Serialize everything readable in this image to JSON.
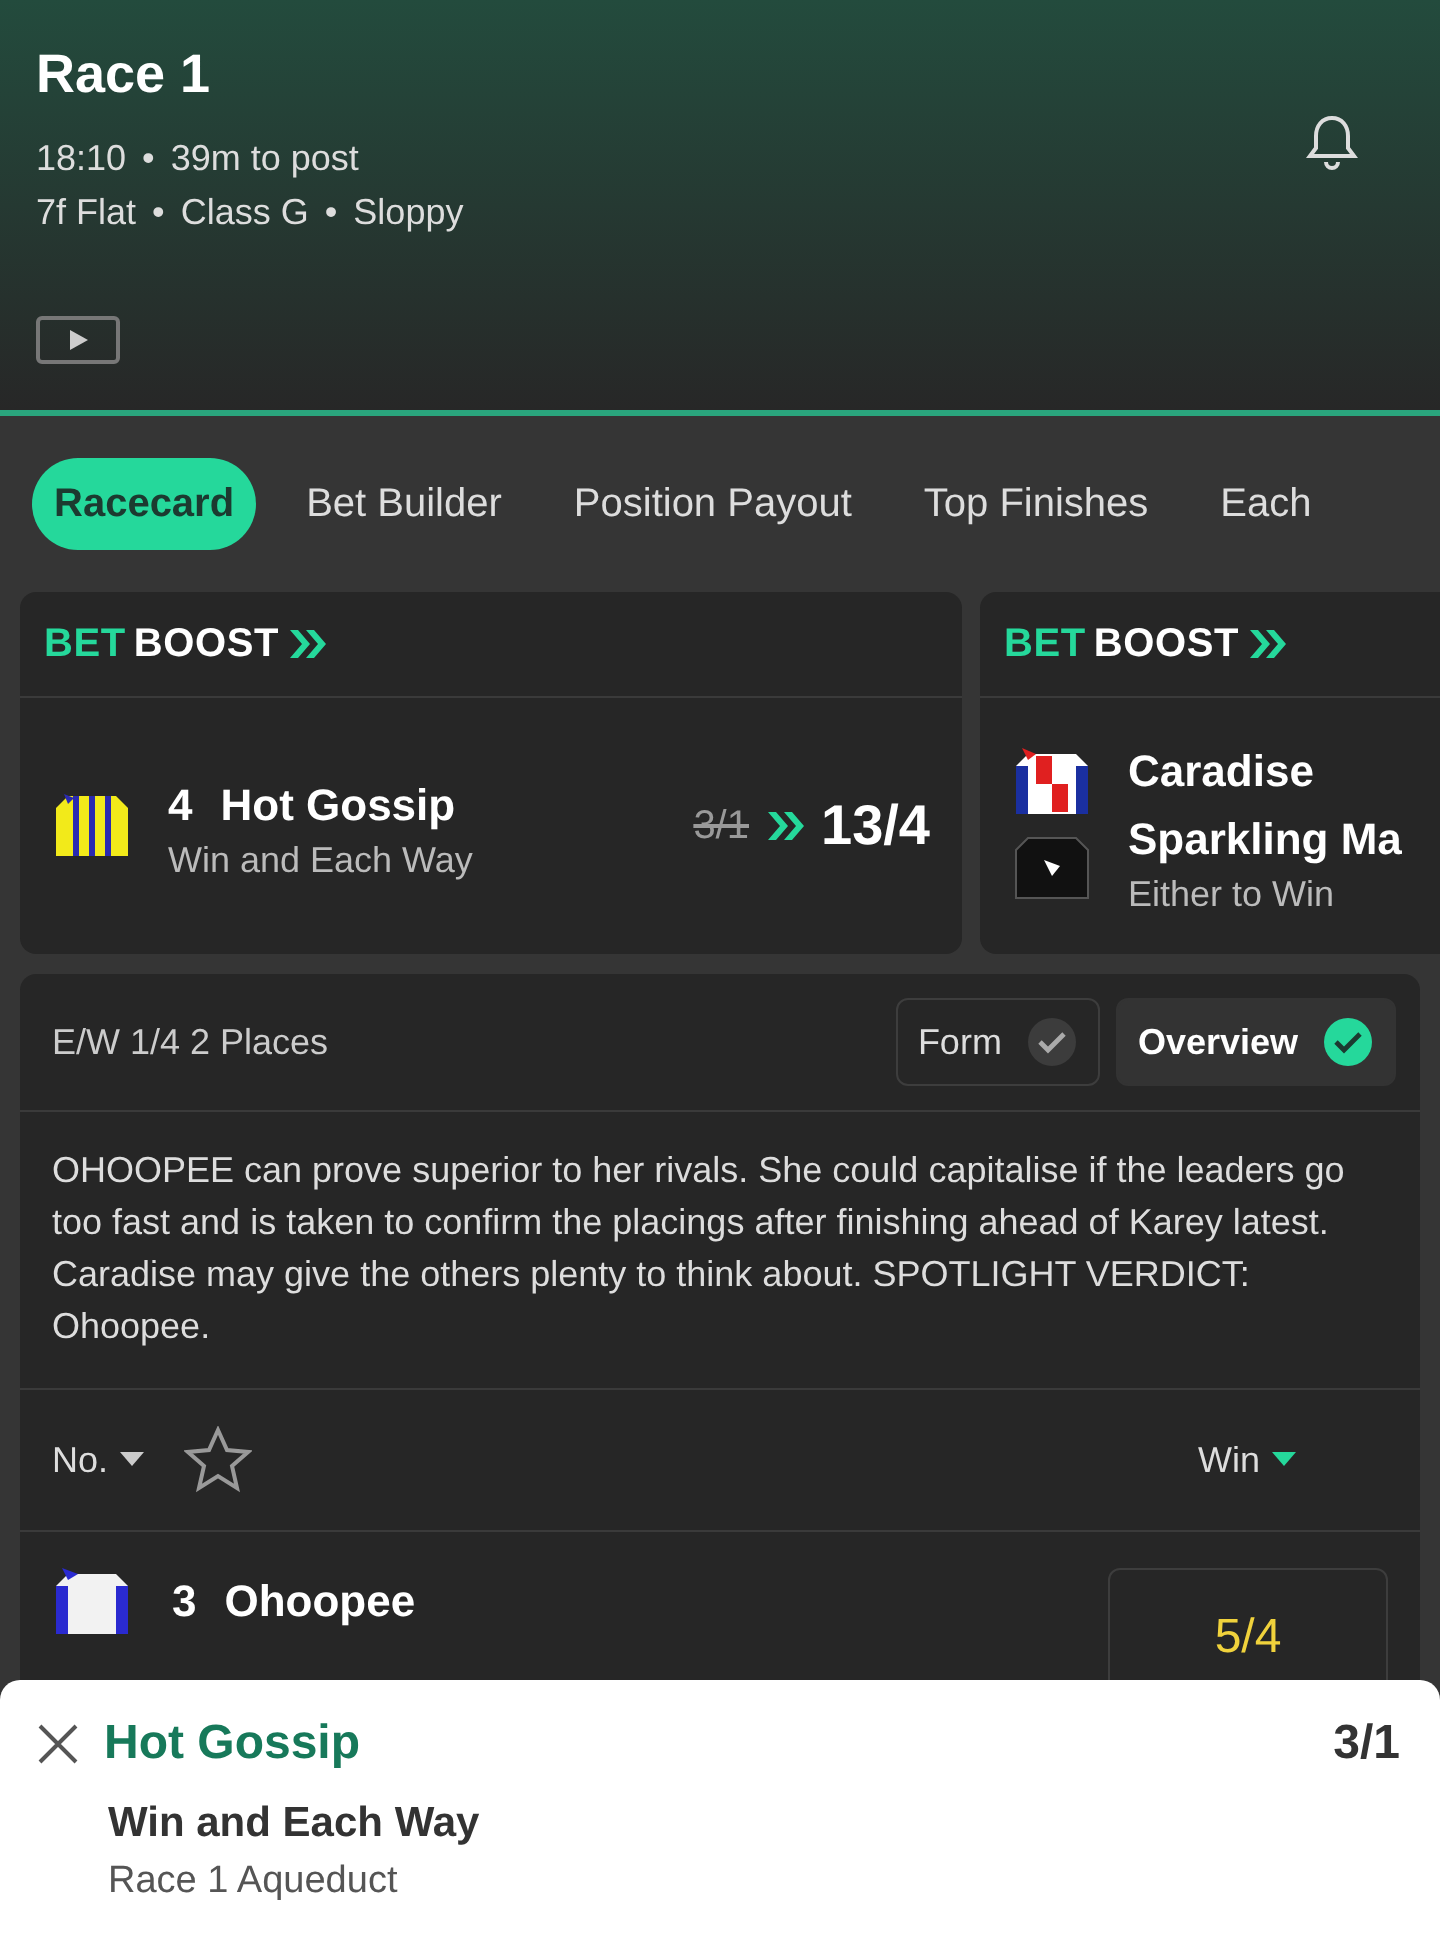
{
  "header": {
    "title": "Race 1",
    "time": "18:10",
    "separator": "•",
    "countdown": "39m to post",
    "details": [
      "7f Flat",
      "Class G",
      "Sloppy"
    ]
  },
  "tabs": [
    {
      "label": "Racecard",
      "selected": true
    },
    {
      "label": "Bet Builder",
      "selected": false
    },
    {
      "label": "Position Payout",
      "selected": false
    },
    {
      "label": "Top Finishes",
      "selected": false
    },
    {
      "label": "Each",
      "selected": false
    }
  ],
  "boosts": [
    {
      "kind": "single",
      "logo_bet": "BET",
      "logo_boost": "BOOST",
      "number": "4",
      "name": "Hot Gossip",
      "market": "Win and Each Way",
      "old_price": "3/1",
      "new_price": "13/4"
    },
    {
      "kind": "double",
      "logo_bet": "BET",
      "logo_boost": "BOOST",
      "names": [
        "Caradise",
        "Sparkling Ma"
      ],
      "market": "Either to Win"
    }
  ],
  "panel": {
    "ew_terms": "E/W 1/4 2 Places",
    "toggles": [
      {
        "label": "Form",
        "selected": false
      },
      {
        "label": "Overview",
        "selected": true
      }
    ],
    "verdict": "OHOOPEE can prove superior to her rivals. She could capitalise if the leaders go too fast and is taken to confirm the placings after finishing ahead of Karey latest. Caradise may give the others plenty to think about. SPOTLIGHT VERDICT: Ohoopee.",
    "sort_label": "No.",
    "price_label": "Win",
    "runners": [
      {
        "number": "3",
        "name": "Ohoopee",
        "price": "5/4"
      }
    ]
  },
  "bet_slip": {
    "name": "Hot Gossip",
    "price": "3/1",
    "market": "Win and Each Way",
    "event": "Race 1 Aqueduct"
  }
}
